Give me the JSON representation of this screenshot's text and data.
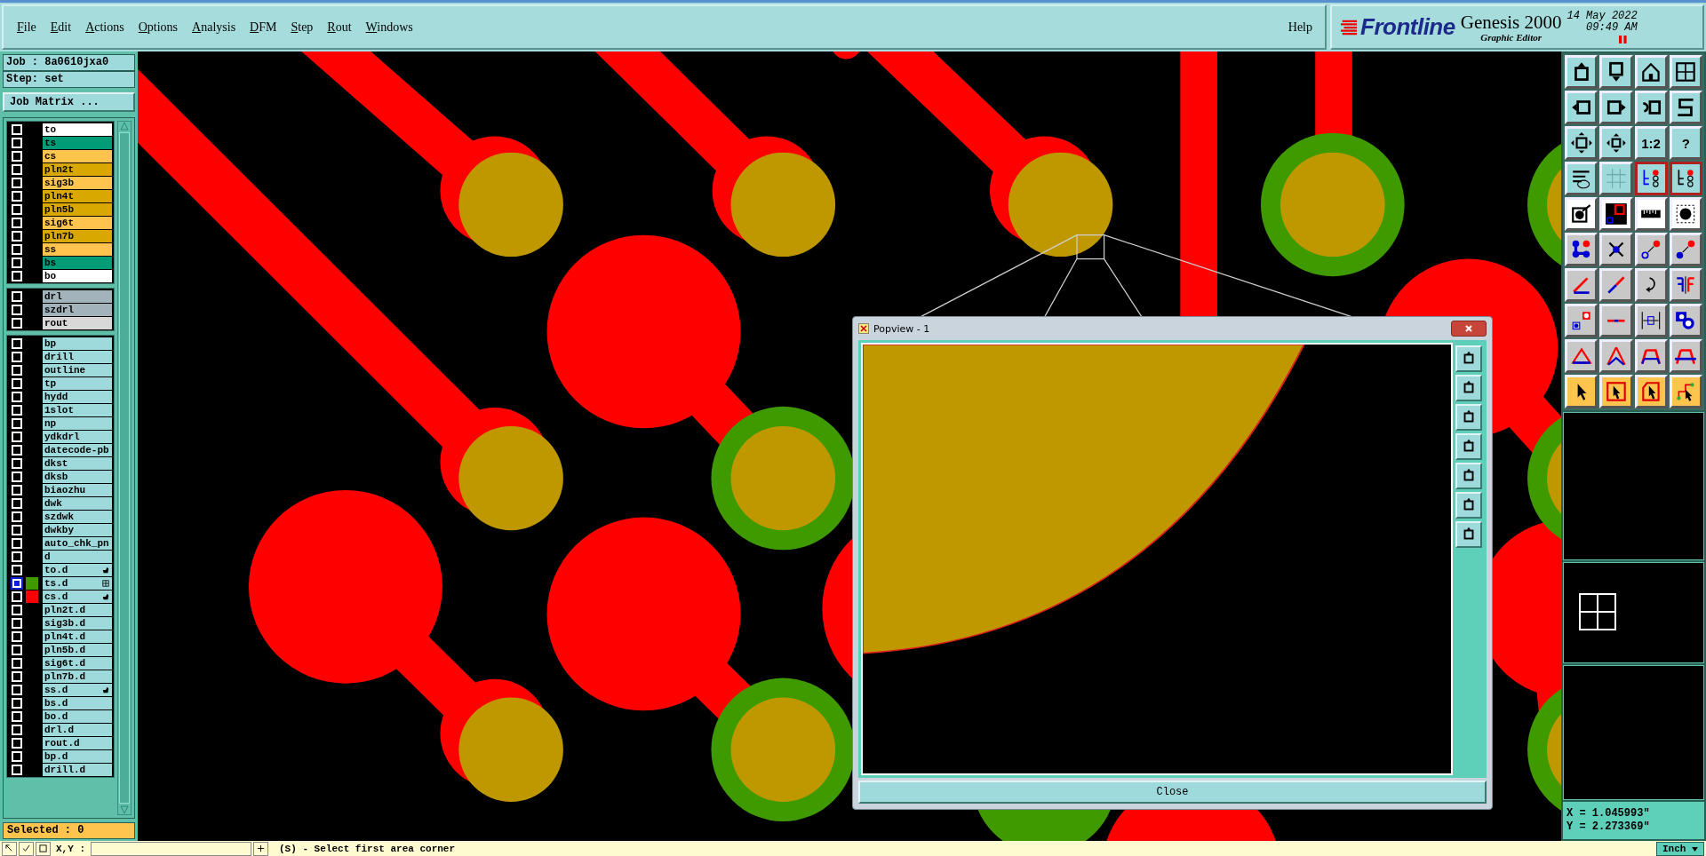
{
  "menu": [
    "File",
    "Edit",
    "Actions",
    "Options",
    "Analysis",
    "DFM",
    "Step",
    "Rout",
    "Windows"
  ],
  "help": "Help",
  "brand": {
    "logo": "Frontline",
    "product": "Genesis 2000",
    "subtitle": "Graphic Editor",
    "date": "14 May 2022",
    "time": "09:49 AM"
  },
  "job": "Job : 8a0610jxa0",
  "step": "Step: set",
  "job_matrix": "Job Matrix ...",
  "layer_groups": [
    {
      "layers": [
        {
          "name": "to",
          "color": "#ffffff",
          "selected": false
        },
        {
          "name": "ts",
          "color": "#009b77",
          "selected": false
        },
        {
          "name": "cs",
          "color": "#ffc44d",
          "selected": false
        },
        {
          "name": "pln2t",
          "color": "#d9a800",
          "selected": false
        },
        {
          "name": "sig3b",
          "color": "#ffc44d",
          "selected": false
        },
        {
          "name": "pln4t",
          "color": "#d9a800",
          "selected": false
        },
        {
          "name": "pln5b",
          "color": "#d9a800",
          "selected": false
        },
        {
          "name": "sig6t",
          "color": "#ffc44d",
          "selected": false
        },
        {
          "name": "pln7b",
          "color": "#d9a800",
          "selected": false
        },
        {
          "name": "ss",
          "color": "#ffc44d",
          "selected": false
        },
        {
          "name": "bs",
          "color": "#009b77",
          "selected": false
        },
        {
          "name": "bo",
          "color": "#ffffff",
          "selected": false
        }
      ]
    },
    {
      "layers": [
        {
          "name": "drl",
          "color": "#a3b3bb",
          "selected": false
        },
        {
          "name": "szdrl",
          "color": "#a3b3bb",
          "selected": false
        },
        {
          "name": "rout",
          "color": "#d8d8d8",
          "selected": false
        }
      ]
    },
    {
      "layers": [
        {
          "name": "bp",
          "color": "#9ed9dc",
          "selected": false
        },
        {
          "name": "drill",
          "color": "#9ed9dc",
          "selected": false
        },
        {
          "name": "outline",
          "color": "#9ed9dc",
          "selected": false
        },
        {
          "name": "tp",
          "color": "#9ed9dc",
          "selected": false
        },
        {
          "name": "hydd",
          "color": "#9ed9dc",
          "selected": false
        },
        {
          "name": "1slot",
          "color": "#9ed9dc",
          "selected": false
        },
        {
          "name": "np",
          "color": "#9ed9dc",
          "selected": false
        },
        {
          "name": "ydkdrl",
          "color": "#9ed9dc",
          "selected": false
        },
        {
          "name": "datecode-pb",
          "color": "#9ed9dc",
          "selected": false
        },
        {
          "name": "dkst",
          "color": "#9ed9dc",
          "selected": false
        },
        {
          "name": "dksb",
          "color": "#9ed9dc",
          "selected": false
        },
        {
          "name": "biaozhu",
          "color": "#9ed9dc",
          "selected": false
        },
        {
          "name": "dwk",
          "color": "#9ed9dc",
          "selected": false
        },
        {
          "name": "szdwk",
          "color": "#9ed9dc",
          "selected": false
        },
        {
          "name": "dwkby",
          "color": "#9ed9dc",
          "selected": false
        },
        {
          "name": "auto_chk_pn",
          "color": "#9ed9dc",
          "selected": false
        },
        {
          "name": "d",
          "color": "#9ed9dc",
          "selected": false
        },
        {
          "name": "to.d",
          "color": "#9ed9dc",
          "selected": false,
          "marker": {
            "kind": "hand"
          }
        },
        {
          "name": "ts.d",
          "color": "#9ed9dc",
          "selected": true,
          "swatch": {
            "color": "#3f9a00"
          },
          "marker": {
            "kind": "grid"
          }
        },
        {
          "name": "cs.d",
          "color": "#9ed9dc",
          "selected": false,
          "swatch": {
            "color": "#ff0000"
          },
          "marker": {
            "kind": "hand"
          }
        },
        {
          "name": "pln2t.d",
          "color": "#9ed9dc",
          "selected": false
        },
        {
          "name": "sig3b.d",
          "color": "#9ed9dc",
          "selected": false
        },
        {
          "name": "pln4t.d",
          "color": "#9ed9dc",
          "selected": false
        },
        {
          "name": "pln5b.d",
          "color": "#9ed9dc",
          "selected": false
        },
        {
          "name": "sig6t.d",
          "color": "#9ed9dc",
          "selected": false
        },
        {
          "name": "pln7b.d",
          "color": "#9ed9dc",
          "selected": false
        },
        {
          "name": "ss.d",
          "color": "#9ed9dc",
          "selected": false,
          "marker": {
            "kind": "hand"
          }
        },
        {
          "name": "bs.d",
          "color": "#9ed9dc",
          "selected": false
        },
        {
          "name": "bo.d",
          "color": "#9ed9dc",
          "selected": false
        },
        {
          "name": "drl.d",
          "color": "#9ed9dc",
          "selected": false
        },
        {
          "name": "rout.d",
          "color": "#9ed9dc",
          "selected": false
        },
        {
          "name": "bp.d",
          "color": "#9ed9dc",
          "selected": false
        },
        {
          "name": "drill.d",
          "color": "#9ed9dc",
          "selected": false
        }
      ]
    }
  ],
  "selected_count": "Selected : 0",
  "toolbar": [
    {
      "kind": "view",
      "on": false
    },
    {
      "kind": "view",
      "on": false
    },
    {
      "kind": "view",
      "on": false
    },
    {
      "kind": "view",
      "on": false
    },
    {
      "kind": "view",
      "on": false
    },
    {
      "kind": "view",
      "on": false
    },
    {
      "kind": "view",
      "on": false
    },
    {
      "kind": "view",
      "on": false
    },
    {
      "kind": "view",
      "on": false
    },
    {
      "kind": "view",
      "on": false
    },
    {
      "kind": "view",
      "on": false,
      "label": "1:2"
    },
    {
      "kind": "view",
      "on": false,
      "label": "?"
    },
    {
      "kind": "view",
      "on": false
    },
    {
      "kind": "view",
      "on": false
    },
    {
      "kind": "view",
      "on": true
    },
    {
      "kind": "view",
      "on": true
    },
    {
      "kind": "mode",
      "on": false
    },
    {
      "kind": "mode",
      "on": false
    },
    {
      "kind": "mode",
      "on": false
    },
    {
      "kind": "mode",
      "on": false
    },
    {
      "kind": "edit",
      "on": false
    },
    {
      "kind": "edit",
      "on": false
    },
    {
      "kind": "edit",
      "on": false
    },
    {
      "kind": "edit",
      "on": false
    },
    {
      "kind": "edit",
      "on": false
    },
    {
      "kind": "edit",
      "on": false
    },
    {
      "kind": "edit",
      "on": false
    },
    {
      "kind": "edit",
      "on": false
    },
    {
      "kind": "edit",
      "on": false
    },
    {
      "kind": "edit",
      "on": false
    },
    {
      "kind": "edit",
      "on": false
    },
    {
      "kind": "edit",
      "on": false
    },
    {
      "kind": "edit",
      "on": false
    },
    {
      "kind": "edit",
      "on": false
    },
    {
      "kind": "edit",
      "on": false
    },
    {
      "kind": "edit",
      "on": false
    },
    {
      "kind": "select",
      "on": false
    },
    {
      "kind": "select",
      "on": false
    },
    {
      "kind": "select",
      "on": false
    },
    {
      "kind": "select",
      "on": false
    }
  ],
  "coordinates": {
    "x": "X = 1.045993\"",
    "y": "Y = 2.273369\""
  },
  "popview": {
    "title": "Popview - 1",
    "close": "Close"
  },
  "command_bar": {
    "label": "X,Y :",
    "message": "(S) - Select first area corner",
    "units": "Inch"
  }
}
